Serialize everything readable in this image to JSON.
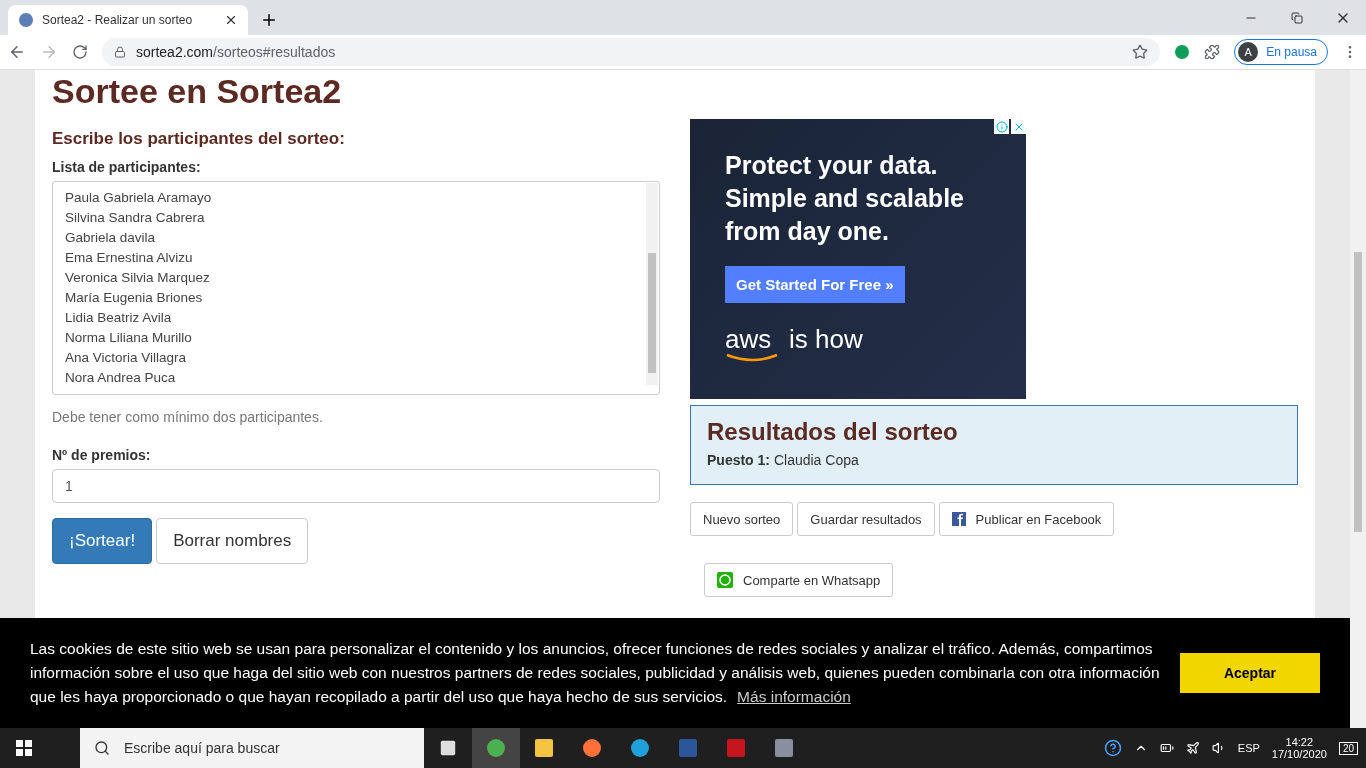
{
  "browser": {
    "tab_title": "Sortea2 - Realizar un sorteo",
    "url_host": "sortea2.com",
    "url_path": "/sorteos#resultados",
    "profile_initial": "A",
    "profile_status": "En pausa"
  },
  "page": {
    "title": "Sortee en Sortea2",
    "subtitle": "Escribe los participantes del sorteo:",
    "list_label": "Lista de participantes:",
    "participants": [
      "Paula Gabriela Aramayo",
      "Silvina Sandra Cabrera",
      "Gabriela davila",
      "Ema Ernestina Alvizu",
      "Veronica Silvia Marquez",
      "María Eugenia Briones",
      "Lidia Beatriz Avila",
      "Norma Liliana Murillo",
      "Ana Victoria Villagra",
      "Nora Andrea Puca"
    ],
    "hint": "Debe tener como mínimo dos participantes.",
    "prizes_label": "Nº de premios:",
    "prizes_value": "1",
    "draw_button": "¡Sortear!",
    "clear_button": "Borrar nombres"
  },
  "ad": {
    "headline": "Protect your data. Simple and scalable from day one.",
    "cta": "Get Started For Free »",
    "brand": "aws",
    "tagline": "is how"
  },
  "results": {
    "title": "Resultados del sorteo",
    "entries": [
      {
        "label": "Puesto 1:",
        "name": "Claudia Copa"
      }
    ]
  },
  "actions": [
    {
      "label": "Nuevo sorteo",
      "kind": "plain"
    },
    {
      "label": "Guardar resultados",
      "kind": "plain"
    },
    {
      "label": "Publicar en Facebook",
      "kind": "facebook"
    }
  ],
  "share": {
    "label": "Comparte en Whatsapp"
  },
  "cookie": {
    "text": "Las cookies de este sitio web se usan para personalizar el contenido y los anuncios, ofrecer funciones de redes sociales y analizar el tráfico. Además, compartimos información sobre el uso que haga del sitio web con nuestros partners de redes sociales, publicidad y análisis web, quienes pueden combinarla con otra información que les haya proporcionado o que hayan recopilado a partir del uso que haya hecho de sus servicios.",
    "link": "Más información",
    "accept": "Aceptar"
  },
  "taskbar": {
    "search_placeholder": "Escribe aquí para buscar",
    "language": "ESP",
    "time": "14:22",
    "date": "17/10/2020",
    "notifications": "20"
  }
}
